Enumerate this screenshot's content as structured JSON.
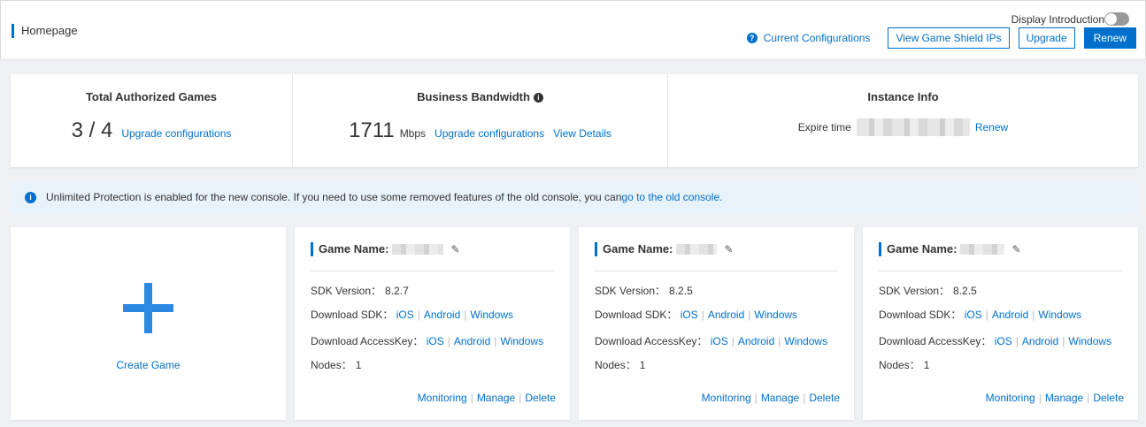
{
  "header": {
    "title": "Homepage",
    "display_intro_label": "Display Introduction",
    "current_config_label": "Current Configurations",
    "view_ips_label": "View Game Shield IPs",
    "upgrade_label": "Upgrade",
    "renew_label": "Renew"
  },
  "stats": {
    "games": {
      "title": "Total Authorized Games",
      "value": "3 / 4",
      "link": "Upgrade configurations"
    },
    "bandwidth": {
      "title": "Business Bandwidth",
      "value": "1711",
      "unit": "Mbps",
      "link1": "Upgrade configurations",
      "link2": "View Details"
    },
    "instance": {
      "title": "Instance Info",
      "expire_label": "Expire time",
      "renew_link": "Renew"
    }
  },
  "notice": {
    "text": "Unlimited Protection is enabled for the new console. If you need to use some removed features of the old console, you can",
    "link": "go to the old console."
  },
  "create_card": {
    "label": "Create Game"
  },
  "games": [
    {
      "name_label": "Game Name:",
      "sdk_label": "SDK Version：",
      "sdk_version": "8.2.7",
      "dl_sdk_label": "Download SDK：",
      "dl_key_label": "Download AccessKey：",
      "platforms": [
        "iOS",
        "Android",
        "Windows"
      ],
      "nodes_label": "Nodes：",
      "nodes": "1",
      "actions": [
        "Monitoring",
        "Manage",
        "Delete"
      ]
    },
    {
      "name_label": "Game Name:",
      "sdk_label": "SDK Version：",
      "sdk_version": "8.2.5",
      "dl_sdk_label": "Download SDK：",
      "dl_key_label": "Download AccessKey：",
      "platforms": [
        "iOS",
        "Android",
        "Windows"
      ],
      "nodes_label": "Nodes：",
      "nodes": "1",
      "actions": [
        "Monitoring",
        "Manage",
        "Delete"
      ]
    },
    {
      "name_label": "Game Name:",
      "sdk_label": "SDK Version：",
      "sdk_version": "8.2.5",
      "dl_sdk_label": "Download SDK：",
      "dl_key_label": "Download AccessKey：",
      "platforms": [
        "iOS",
        "Android",
        "Windows"
      ],
      "nodes_label": "Nodes：",
      "nodes": "1",
      "actions": [
        "Monitoring",
        "Manage",
        "Delete"
      ]
    }
  ],
  "colors": {
    "accent": "#0070cc",
    "plus": "#2d8ae2",
    "notice_bg": "#e8f2fb"
  }
}
